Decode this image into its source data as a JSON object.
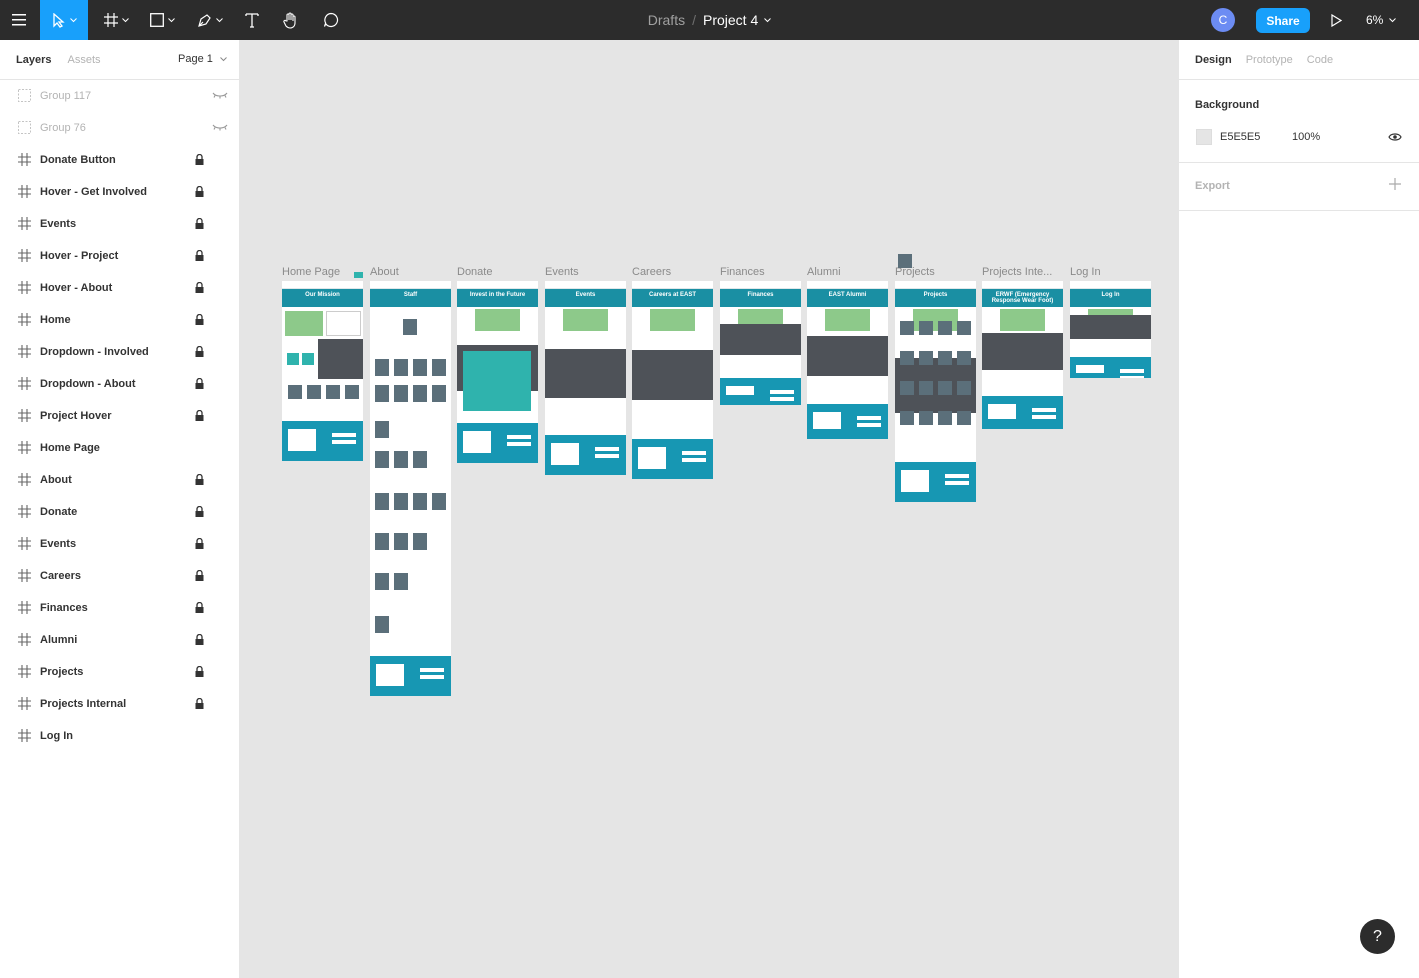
{
  "toolbar": {
    "breadcrumb_parent": "Drafts",
    "breadcrumb_separator": "/",
    "project_name": "Project 4",
    "avatar_initial": "C",
    "share_label": "Share",
    "zoom": "6%"
  },
  "left_panel": {
    "tabs": [
      "Layers",
      "Assets"
    ],
    "page": "Page 1",
    "layers": [
      {
        "name": "Group 117",
        "hidden": true,
        "locked": false
      },
      {
        "name": "Group 76",
        "hidden": true,
        "locked": false
      },
      {
        "name": "Donate Button",
        "hidden": false,
        "locked": true
      },
      {
        "name": "Hover - Get Involved",
        "hidden": false,
        "locked": true
      },
      {
        "name": "Events",
        "hidden": false,
        "locked": true
      },
      {
        "name": "Hover - Project",
        "hidden": false,
        "locked": true
      },
      {
        "name": "Hover - About",
        "hidden": false,
        "locked": true
      },
      {
        "name": "Home",
        "hidden": false,
        "locked": true
      },
      {
        "name": "Dropdown - Involved",
        "hidden": false,
        "locked": true
      },
      {
        "name": "Dropdown - About",
        "hidden": false,
        "locked": true
      },
      {
        "name": "Project Hover",
        "hidden": false,
        "locked": true
      },
      {
        "name": "Home Page",
        "hidden": false,
        "locked": false
      },
      {
        "name": "About",
        "hidden": false,
        "locked": true
      },
      {
        "name": "Donate",
        "hidden": false,
        "locked": true
      },
      {
        "name": "Events",
        "hidden": false,
        "locked": true
      },
      {
        "name": "Careers",
        "hidden": false,
        "locked": true
      },
      {
        "name": "Finances",
        "hidden": false,
        "locked": true
      },
      {
        "name": "Alumni",
        "hidden": false,
        "locked": true
      },
      {
        "name": "Projects",
        "hidden": false,
        "locked": true
      },
      {
        "name": "Projects Internal",
        "hidden": false,
        "locked": true
      },
      {
        "name": "Log In",
        "hidden": false,
        "locked": false
      }
    ]
  },
  "right_panel": {
    "tabs": [
      "Design",
      "Prototype",
      "Code"
    ],
    "background_label": "Background",
    "background_hex": "E5E5E5",
    "background_opacity": "100%",
    "export_label": "Export",
    "help": "?"
  },
  "canvas": {
    "frames": [
      {
        "label": "Home Page",
        "hero": "Our Mission"
      },
      {
        "label": "About",
        "hero": "Staff"
      },
      {
        "label": "Donate",
        "hero": "Invest in the Future"
      },
      {
        "label": "Events",
        "hero": "Events"
      },
      {
        "label": "Careers",
        "hero": "Careers at EAST"
      },
      {
        "label": "Finances",
        "hero": "Finances"
      },
      {
        "label": "Alumni",
        "hero": "EAST Alumni"
      },
      {
        "label": "Projects",
        "hero": "Projects"
      },
      {
        "label": "Projects Inte...",
        "hero": "ERWF (Emergency Response Wear Foot)"
      },
      {
        "label": "Log In",
        "hero": "Log In"
      }
    ]
  },
  "colors": {
    "toolbar": "#2c2c2c",
    "accent": "#18a0fb",
    "frame_teal": "#1797b3",
    "frame_dark": "#4e5258",
    "frame_green": "#8dc98a"
  }
}
